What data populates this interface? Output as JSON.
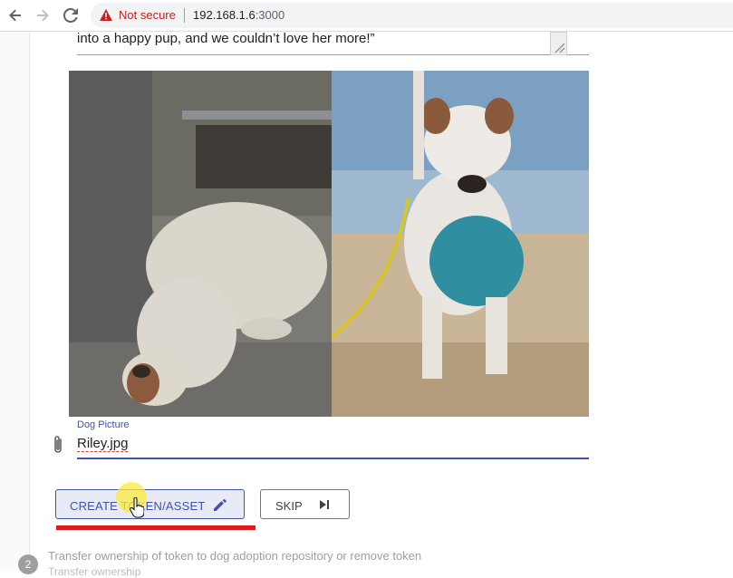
{
  "browser": {
    "security_label": "Not secure",
    "url_host": "192.168.1.6",
    "url_port": ":3000",
    "icons": [
      "back-arrow-icon",
      "forward-arrow-icon",
      "reload-icon",
      "warning-icon"
    ]
  },
  "form": {
    "story_tail": "into a happy pup, and we couldn’t love her more!”",
    "file_field": {
      "label": "Dog Picture",
      "value": "Riley.jpg",
      "icon": "paperclip-icon"
    },
    "buttons": {
      "create_label": "CREATE TOKEN/ASSET",
      "create_icon": "pencil-icon",
      "skip_label": "SKIP",
      "skip_icon": "skip-next-icon"
    }
  },
  "next_step": {
    "number": "2",
    "title": "Transfer ownership of token to dog adoption repository or remove token",
    "subtitle": "Transfer ownership"
  },
  "colors": {
    "accent": "#3f51b5",
    "warning": "#c5221f",
    "annotation_underline": "#e0191b"
  }
}
